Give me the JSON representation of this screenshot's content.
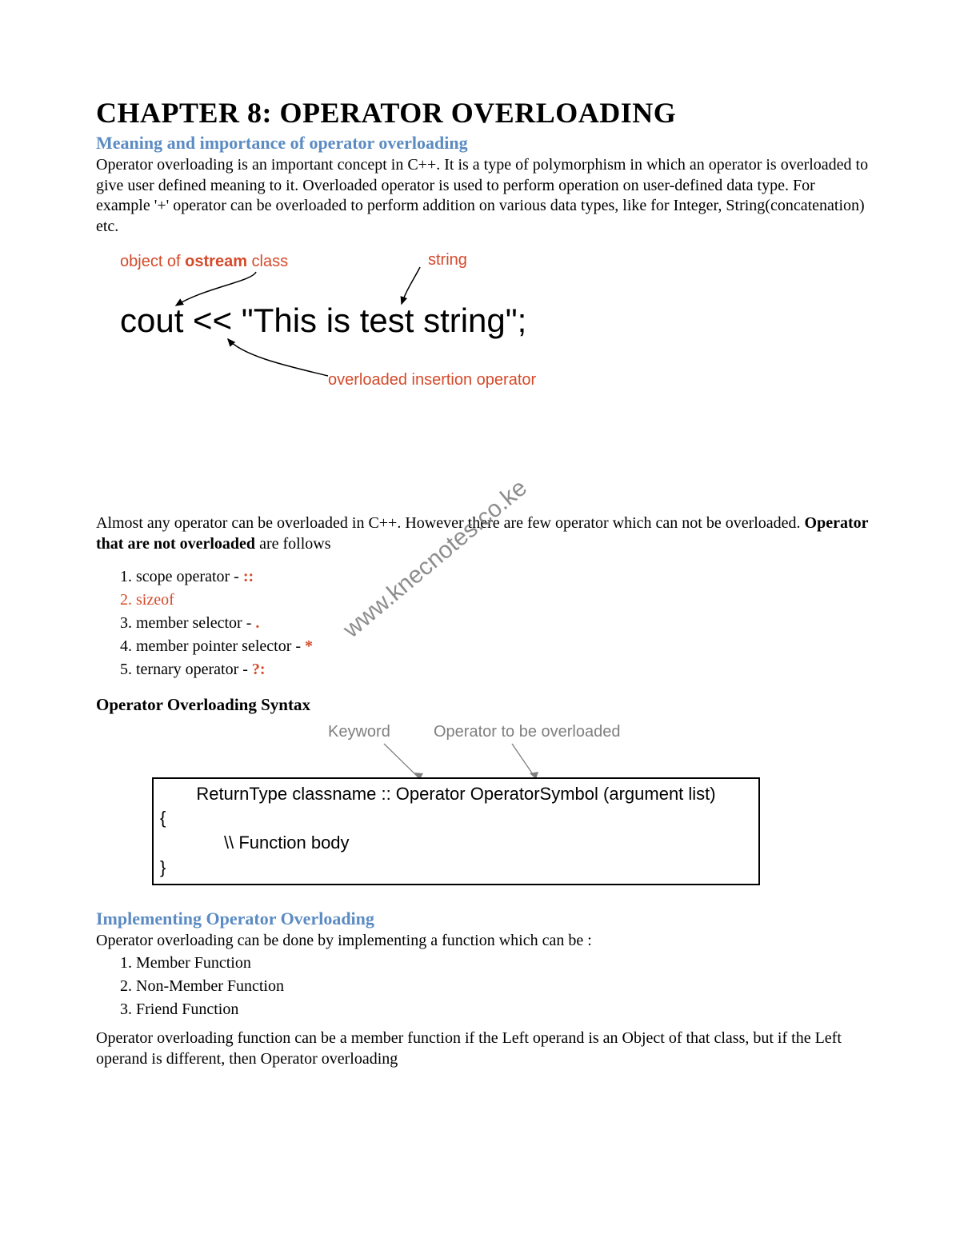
{
  "chapter_title": "CHAPTER 8: OPERATOR OVERLOADING",
  "section1": {
    "heading": "Meaning and importance of operator overloading",
    "para": "Operator overloading is an important concept in C++. It is a type of polymorphism in which an operator is overloaded to give user defined meaning to it. Overloaded operator is used to perform operation on user-defined data type. For example '+' operator can be overloaded to perform addition on various data types, like for Integer, String(concatenation) etc."
  },
  "fig1": {
    "label_ostream_pre": "object of ",
    "label_ostream_bold": "ostream",
    "label_ostream_post": " class",
    "label_string": "string",
    "label_overloaded": "overloaded insertion operator",
    "code": "cout << \"This is test string\";"
  },
  "watermark": "www.knecnotes.co.ke",
  "section2": {
    "para_pre": "Almost any operator can be overloaded in C++. However there are few operator which can not be overloaded. ",
    "para_bold": "Operator that are not overloaded",
    "para_post": " are follows",
    "items": [
      {
        "text": "scope operator - ",
        "sym": "::",
        "all_red": false
      },
      {
        "text": "sizeof",
        "sym": "",
        "all_red": true
      },
      {
        "text": "member selector - ",
        "sym": ".",
        "all_red": false
      },
      {
        "text": "member pointer selector - ",
        "sym": "*",
        "all_red": false
      },
      {
        "text": "ternary operator - ",
        "sym": "?:",
        "all_red": false
      }
    ]
  },
  "syntax": {
    "heading": "Operator Overloading Syntax",
    "annot_keyword": "Keyword",
    "annot_op": "Operator to be overloaded",
    "line1": "ReturnType classname :: Operator OperatorSymbol (argument list)",
    "brace_open": "{",
    "line2": "\\\\ Function body",
    "brace_close": "}"
  },
  "section3": {
    "heading": "Implementing Operator Overloading",
    "para": "Operator overloading can be done by implementing a function which can be :",
    "items": [
      "Member Function",
      "Non-Member Function",
      "Friend Function"
    ],
    "para2": "Operator overloading function can be a member function if the Left operand is an Object of that class, but if the Left operand is different, then Operator overloading"
  }
}
